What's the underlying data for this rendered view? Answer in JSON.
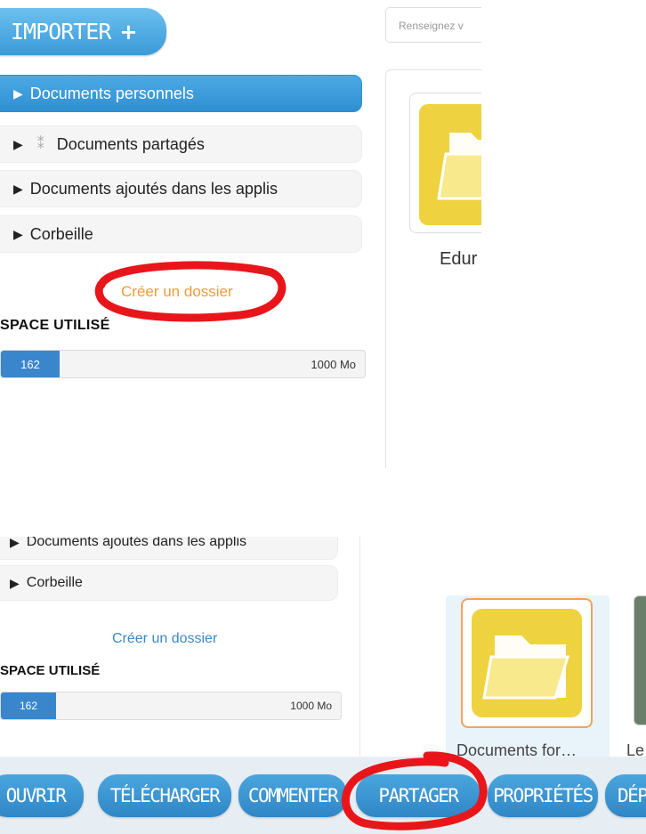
{
  "top": {
    "importer_label": "IMPORTER",
    "importer_icon": "+",
    "search_placeholder": "Renseignez v",
    "nav_items": [
      {
        "label": "Documents personnels",
        "active": true
      },
      {
        "label": "Documents partagés",
        "active": false
      },
      {
        "label": "Documents ajoutés dans les applis",
        "active": false
      },
      {
        "label": "Corbeille",
        "active": false
      }
    ],
    "create_folder": "Créer un dossier",
    "space_label": "SPACE UTILISÉ",
    "storage": {
      "used": "162",
      "total": "1000 Mo",
      "used_fraction": 0.162
    },
    "folder_name": "Edur"
  },
  "bottom": {
    "nav_items": [
      {
        "label": "Documents ajoutés dans les applis"
      },
      {
        "label": "Corbeille"
      }
    ],
    "create_folder": "Créer un dossier",
    "space_label": "SPACE UTILISÉ",
    "storage": {
      "used": "162",
      "total": "1000 Mo",
      "used_fraction": 0.162
    },
    "selected_folder_name": "Documents for…",
    "other_item_name": "Le",
    "actions": [
      "OUVRIR",
      "TÉLÉCHARGER",
      "COMMENTER",
      "PARTAGER",
      "PROPRIÉTÉS",
      "DÉP"
    ]
  },
  "colors": {
    "accent_blue": "#3a9ad8",
    "folder_yellow": "#efd23f",
    "create_folder_orange": "#f29a3a",
    "annotation_red": "#e8161b"
  }
}
